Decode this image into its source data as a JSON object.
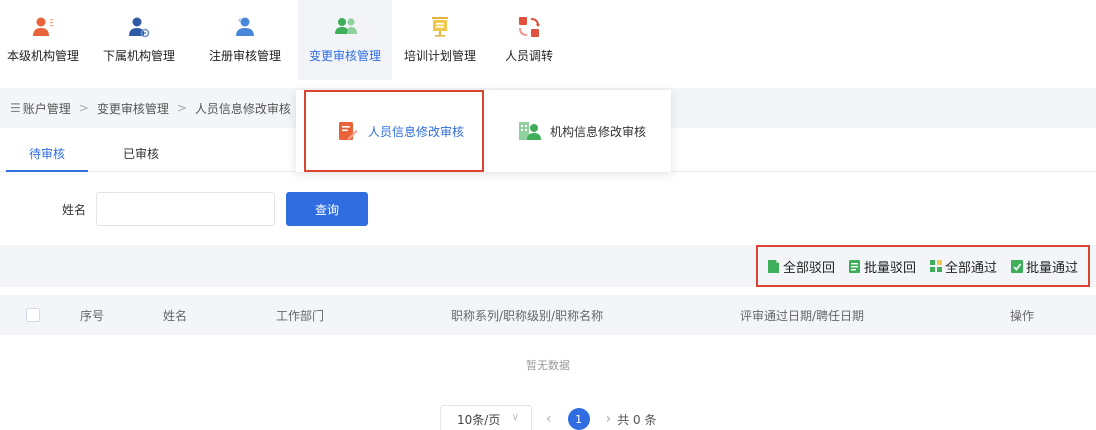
{
  "nav": [
    {
      "label": "本级机构管理",
      "icon": "person-orange-icon"
    },
    {
      "label": "下属机构管理",
      "icon": "person-gear-icon"
    },
    {
      "label": "注册审核管理",
      "icon": "person-register-icon"
    },
    {
      "label": "变更审核管理",
      "icon": "people-group-icon",
      "active": true
    },
    {
      "label": "培训计划管理",
      "icon": "presentation-board-icon"
    },
    {
      "label": "人员调转",
      "icon": "transfer-icon"
    }
  ],
  "breadcrumb": {
    "items": [
      "账户管理",
      "变更审核管理",
      "人员信息修改审核"
    ],
    "separator": ">"
  },
  "dropdown": {
    "items": [
      {
        "label": "人员信息修改审核",
        "icon": "edit-document-icon"
      },
      {
        "label": "机构信息修改审核",
        "icon": "organization-icon"
      }
    ]
  },
  "tabs": [
    {
      "label": "待审核",
      "active": true
    },
    {
      "label": "已审核"
    }
  ],
  "search": {
    "name_label": "姓名",
    "name_value": "",
    "button_label": "查询"
  },
  "actions": [
    {
      "label": "全部驳回",
      "icon": "reject-all-icon"
    },
    {
      "label": "批量驳回",
      "icon": "batch-reject-icon"
    },
    {
      "label": "全部通过",
      "icon": "approve-all-icon"
    },
    {
      "label": "批量通过",
      "icon": "batch-approve-icon"
    }
  ],
  "table": {
    "columns": [
      "序号",
      "姓名",
      "工作部门",
      "职称系列/职称级别/职称名称",
      "评审通过日期/聘任日期",
      "操作"
    ],
    "empty_text": "暂无数据"
  },
  "pagination": {
    "page_size": "10条/页",
    "current_page": "1",
    "total": "共 0 条"
  },
  "colors": {
    "accent": "#2f6de1",
    "highlight_box": "#d9452e",
    "orange": "#e8623a",
    "green": "#3fae5a"
  }
}
